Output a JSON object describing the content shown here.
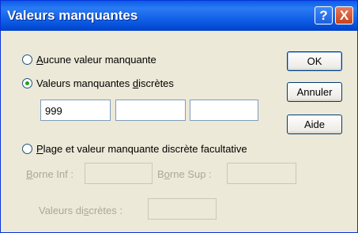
{
  "window": {
    "title": "Valeurs manquantes"
  },
  "titlebar": {
    "help_glyph": "?",
    "close_glyph": "X",
    "help_icon": "help-icon",
    "close_icon": "close-icon"
  },
  "options": {
    "none": {
      "before": "",
      "accel": "A",
      "after": "ucune valeur manquante",
      "checked": false
    },
    "discrete": {
      "before": "Valeurs manquantes ",
      "accel": "d",
      "after": "iscrètes",
      "checked": true
    },
    "range": {
      "before": "",
      "accel": "P",
      "after": "lage et valeur manquante discrète facultative",
      "checked": false
    }
  },
  "discrete_values": [
    "999",
    "",
    ""
  ],
  "range": {
    "lower_label_accel": "B",
    "lower_label_rest": "orne Inf :",
    "upper_label_pre": "B",
    "upper_label_accel": "o",
    "upper_label_rest": "rne Sup :",
    "discrete_label_pre": "Valeurs di",
    "discrete_label_accel": "s",
    "discrete_label_rest": "crètes :",
    "lower_value": "",
    "upper_value": "",
    "discrete_value": ""
  },
  "buttons": {
    "ok": "OK",
    "cancel": "Annuler",
    "help": "Aide"
  },
  "colors": {
    "titlebar": "#0a5de6",
    "dialog_bg": "#ece9d8",
    "disabled_text": "#aca899",
    "radio_dot": "#21a121"
  }
}
